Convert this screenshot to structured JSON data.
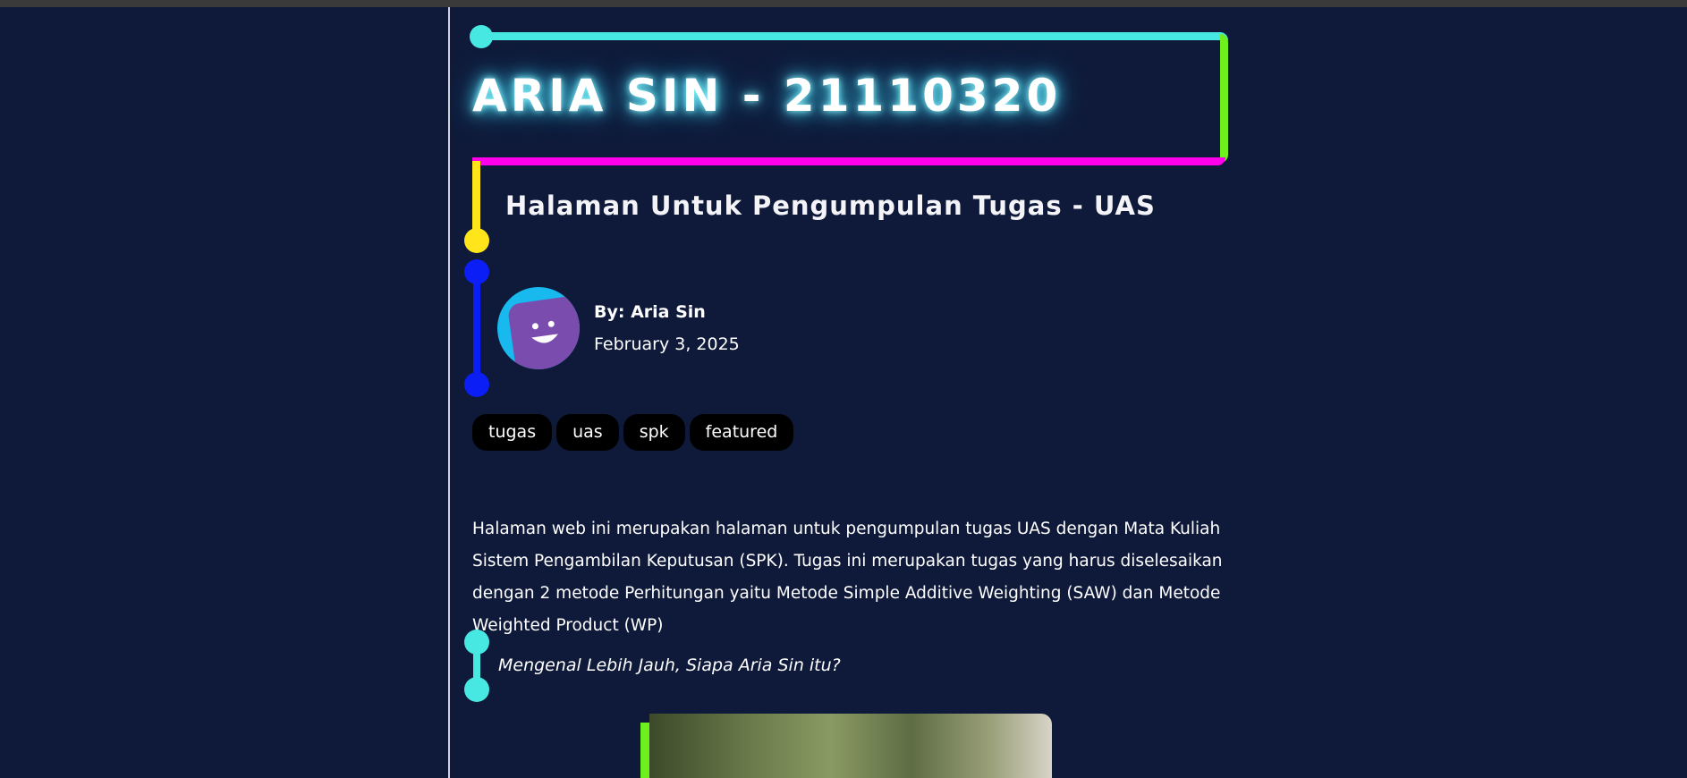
{
  "header": {
    "title": "ARIA SIN - 21110320",
    "subtitle": "Halaman Untuk Pengumpulan Tugas - UAS"
  },
  "author": {
    "byline": "By: Aria Sin",
    "date": "February 3, 2025"
  },
  "tags": [
    "tugas",
    "uas",
    "spk",
    "featured"
  ],
  "intro": "Halaman web ini merupakan halaman untuk pengumpulan tugas UAS dengan Mata Kuliah Sistem Pengambilan Keputusan (SPK). Tugas ini merupakan tugas yang harus diselesaikan dengan 2 metode Perhitungan yaitu Metode Simple Additive Weighting (SAW) dan Metode Weighted Product (WP)",
  "quote": "Mengenal Lebih Jauh, Siapa Aria Sin itu?",
  "colors": {
    "background": "#0f1a3a",
    "cyan": "#48e8e2",
    "green": "#6ef01e",
    "magenta": "#ff00ea",
    "yellow": "#ffe51a",
    "blue": "#0a1ef5"
  },
  "icons": {
    "avatar": "smiley-avatar-icon"
  }
}
